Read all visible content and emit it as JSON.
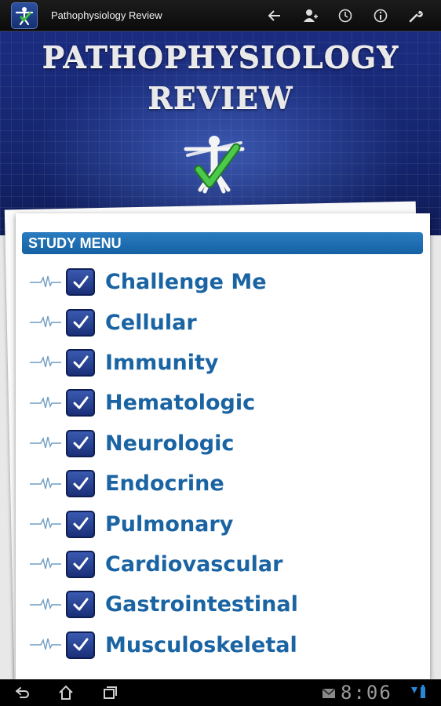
{
  "action_bar": {
    "title": "Pathophysiology Review",
    "icons": [
      "back-arrow-icon",
      "add-person-icon",
      "clock-icon",
      "info-icon",
      "wrench-icon"
    ]
  },
  "banner": {
    "title_line1": "PATHOPHYSIOLOGY",
    "title_line2": "REVIEW"
  },
  "study_menu": {
    "header": "STUDY MENU",
    "items": [
      {
        "label": "Challenge Me"
      },
      {
        "label": "Cellular"
      },
      {
        "label": "Immunity"
      },
      {
        "label": "Hematologic"
      },
      {
        "label": "Neurologic"
      },
      {
        "label": "Endocrine"
      },
      {
        "label": "Pulmonary"
      },
      {
        "label": "Cardiovascular"
      },
      {
        "label": "Gastrointestinal"
      },
      {
        "label": "Musculoskeletal"
      }
    ]
  },
  "system_bar": {
    "time": "8:06",
    "icons": [
      "back-nav-icon",
      "home-icon",
      "recent-apps-icon",
      "mail-icon",
      "signal-icon"
    ]
  },
  "colors": {
    "accent": "#1a64a3",
    "header_bg": "#1561a4",
    "banner_bg": "#15256e",
    "check_bg": "#1a2f78"
  }
}
